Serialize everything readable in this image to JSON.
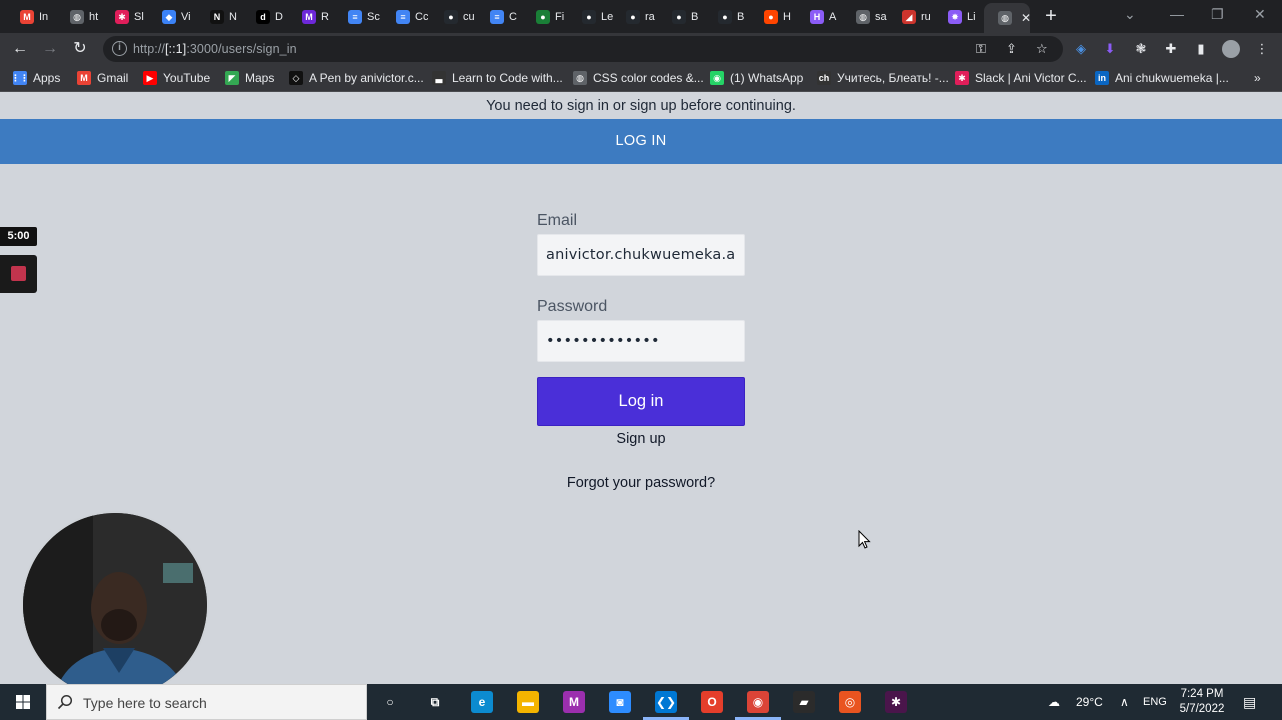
{
  "browser": {
    "tabs": [
      {
        "label": "In",
        "icon": "gmail-icon",
        "color": "#ea4335",
        "glyph": "M"
      },
      {
        "label": "ht",
        "icon": "globe-icon",
        "color": "#5f6368",
        "glyph": "◍"
      },
      {
        "label": "Sl",
        "icon": "slack-icon",
        "color": "#e01e5a",
        "glyph": "✱"
      },
      {
        "label": "Vi",
        "icon": "vercel-icon",
        "color": "#3b82f6",
        "glyph": "◆"
      },
      {
        "label": "N",
        "icon": "notion-icon",
        "color": "#111111",
        "glyph": "N"
      },
      {
        "label": "D",
        "icon": "dev-icon",
        "color": "#000000",
        "glyph": "d"
      },
      {
        "label": "R",
        "icon": "miro-icon",
        "color": "#6d28d9",
        "glyph": "M"
      },
      {
        "label": "Sc",
        "icon": "docs-icon",
        "color": "#4285f4",
        "glyph": "≡"
      },
      {
        "label": "Cc",
        "icon": "docs-icon",
        "color": "#4285f4",
        "glyph": "≡"
      },
      {
        "label": "cu",
        "icon": "github-icon",
        "color": "#24292f",
        "glyph": "●"
      },
      {
        "label": "C",
        "icon": "docs-icon",
        "color": "#4285f4",
        "glyph": "≡"
      },
      {
        "label": "Fi",
        "icon": "github-icon",
        "color": "#1a7f37",
        "glyph": "●"
      },
      {
        "label": "Le",
        "icon": "github-icon",
        "color": "#24292f",
        "glyph": "●"
      },
      {
        "label": "ra",
        "icon": "github-icon",
        "color": "#24292f",
        "glyph": "●"
      },
      {
        "label": "B",
        "icon": "github-icon",
        "color": "#24292f",
        "glyph": "●"
      },
      {
        "label": "B",
        "icon": "github-icon",
        "color": "#24292f",
        "glyph": "●"
      },
      {
        "label": "H",
        "icon": "reddit-icon",
        "color": "#ff4500",
        "glyph": "●"
      },
      {
        "label": "A",
        "icon": "hashnode-icon",
        "color": "#8b5cf6",
        "glyph": "H"
      },
      {
        "label": "sa",
        "icon": "globe-icon",
        "color": "#5f6368",
        "glyph": "◍"
      },
      {
        "label": "ru",
        "icon": "ruby-icon",
        "color": "#cc342d",
        "glyph": "◢"
      },
      {
        "label": "Li",
        "icon": "sparkle-icon",
        "color": "#8b5cf6",
        "glyph": "✸"
      }
    ],
    "active_tab": {
      "label": "",
      "icon": "globe-icon",
      "color": "#5f6368",
      "glyph": "◍"
    },
    "url_prefix": "http://",
    "url_host": "[::1]",
    "url_rest": ":3000/users/sign_in",
    "bookmarks": [
      {
        "label": "Apps",
        "icon": "apps-grid-icon",
        "color": "#4285f4",
        "glyph": "⋮⋮"
      },
      {
        "label": "Gmail",
        "icon": "gmail-icon",
        "color": "#ea4335",
        "glyph": "M"
      },
      {
        "label": "YouTube",
        "icon": "youtube-icon",
        "color": "#ff0000",
        "glyph": "▶"
      },
      {
        "label": "Maps",
        "icon": "maps-icon",
        "color": "#34a853",
        "glyph": "◤"
      },
      {
        "label": "A Pen by anivictor.c...",
        "icon": "codepen-icon",
        "color": "#111111",
        "glyph": "◇"
      },
      {
        "label": "Learn to Code with...",
        "icon": "freecodecamp-icon",
        "color": "#333333",
        "glyph": "▃"
      },
      {
        "label": "CSS color codes &...",
        "icon": "globe-icon",
        "color": "#5f6368",
        "glyph": "◍"
      },
      {
        "label": "(1) WhatsApp",
        "icon": "whatsapp-icon",
        "color": "#25d366",
        "glyph": "◉"
      },
      {
        "label": "Учитесь, Блеать! -...",
        "icon": "channel-icon",
        "color": "#333333",
        "glyph": "ch"
      },
      {
        "label": "Slack | Ani Victor C...",
        "icon": "slack-icon",
        "color": "#e01e5a",
        "glyph": "✱"
      },
      {
        "label": "Ani chukwuemeka |...",
        "icon": "linkedin-icon",
        "color": "#0a66c2",
        "glyph": "in"
      }
    ]
  },
  "page": {
    "notice": "You need to sign in or sign up before continuing.",
    "header": "LOG IN",
    "email_label": "Email",
    "email_value": "anivictor.chukwuemeka.av",
    "password_label": "Password",
    "password_value": "•••••••••••••",
    "login_button": "Log in",
    "signup_link": "Sign up",
    "forgot_link": "Forgot your password?"
  },
  "overlay": {
    "timer": "5:00"
  },
  "taskbar": {
    "search_placeholder": "Type here to search",
    "apps": [
      {
        "name": "cortana-icon",
        "color": "#1f2a33",
        "glyph": "○"
      },
      {
        "name": "task-view-icon",
        "color": "#1f2a33",
        "glyph": "⧉"
      },
      {
        "name": "edge-icon",
        "color": "#0c8bd0",
        "glyph": "e"
      },
      {
        "name": "file-explorer-icon",
        "color": "#f4b400",
        "glyph": "▬"
      },
      {
        "name": "mega-icon",
        "color": "#9b2fae",
        "glyph": "M"
      },
      {
        "name": "zoom-icon",
        "color": "#2d8cff",
        "glyph": "◙"
      },
      {
        "name": "vscode-icon",
        "color": "#0078d4",
        "glyph": "❮❯"
      },
      {
        "name": "office-icon",
        "color": "#e43e2b",
        "glyph": "O"
      },
      {
        "name": "chrome-icon",
        "color": "#db4437",
        "glyph": "◉"
      },
      {
        "name": "sticky-notes-icon",
        "color": "#2b2b2b",
        "glyph": "▰"
      },
      {
        "name": "ubuntu-icon",
        "color": "#e95420",
        "glyph": "◎"
      },
      {
        "name": "slack-icon",
        "color": "#4a154b",
        "glyph": "✱"
      }
    ],
    "temperature": "29°C",
    "language": "ENG",
    "time": "7:24 PM",
    "date": "5/7/2022"
  }
}
